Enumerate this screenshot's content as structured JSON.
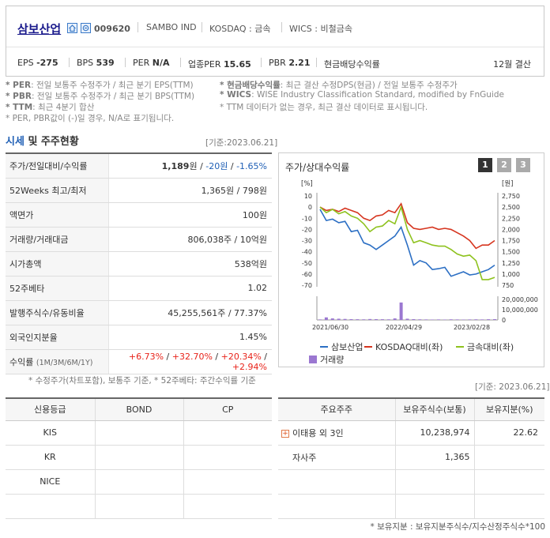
{
  "company": {
    "name": "삼보산업",
    "code": "009620",
    "eng_name": "SAMBO IND",
    "market": "KOSDAQ : 금속",
    "wics": "WICS : 비철금속"
  },
  "metrics": [
    {
      "label": "EPS",
      "value": "-275"
    },
    {
      "label": "BPS",
      "value": "539"
    },
    {
      "label": "PER",
      "value": "N/A"
    },
    {
      "label": "업종PER",
      "value": "15.65"
    },
    {
      "label": "PBR",
      "value": "2.21"
    },
    {
      "label": "현금배당수익률",
      "value": ""
    }
  ],
  "fiscal": "12월 결산",
  "notes": {
    "l1_key": "* PER",
    "l1": ": 전일 보통주 수정주가 / 최근 분기 EPS(TTM)",
    "l2_key": "* PBR",
    "l2": ": 전일 보통주 수정주가 / 최근 분기 BPS(TTM)",
    "l3_key": "* TTM",
    "l3": ": 최근 4분기 합산",
    "l4": "* PER, PBR값이 (-)일 경우, N/A로 표기됩니다.",
    "r1_key": "* 현금배당수익률",
    "r1": ": 최근 결산 수정DPS(현금) / 전일 보통주 수정주가",
    "r2_key": "* WICS",
    "r2": ": WISE Industry Classification Standard, modified by FnGuide",
    "r3": "* TTM 데이터가 없는 경우, 최근 결산 데이터로 표시됩니다."
  },
  "section": {
    "title_a": "시세",
    "title_b": " 및 주주현황",
    "asof": "[기준:2023.06.21]",
    "asof2": "[기준: 2023.06.21]"
  },
  "price_table": [
    {
      "k": "주가/전일대비/수익률",
      "v1": "1,189",
      "v1_unit": "원 / ",
      "v2": "-20원",
      "v3": " / ",
      "v4": "-1.65%"
    },
    {
      "k": "52Weeks 최고/최저",
      "v": "1,365원 / 798원"
    },
    {
      "k": "액면가",
      "v": "100원"
    },
    {
      "k": "거래량/거래대금",
      "v": "806,038주 / 10억원"
    },
    {
      "k": "시가총액",
      "v": "538억원"
    },
    {
      "k": "52주베타",
      "v": "1.02"
    },
    {
      "k": "발행주식수/유동비율",
      "v": "45,255,561주 / 77.37%"
    },
    {
      "k": "외국인지분율",
      "v": "1.45%"
    }
  ],
  "returns": {
    "label": "수익률",
    "periods": "(1M/3M/6M/1Y)",
    "values": [
      "+6.73%",
      "+32.70%",
      "+20.34%",
      "+2.94%"
    ]
  },
  "price_note": "* 수정주가(차트포함), 보통주 기준, * 52주베타: 주간수익률 기준",
  "chart": {
    "title": "주가/상대수익률",
    "buttons": [
      "1",
      "2",
      "3"
    ],
    "left_unit": "[%]",
    "right_unit": "[원]",
    "legend": [
      "삼보산업",
      "KOSDAQ대비(좌)",
      "금속대비(좌)",
      "거래량"
    ]
  },
  "chart_data": {
    "type": "line",
    "x_ticks": [
      "2021/06/30",
      "2022/04/29",
      "2023/02/28"
    ],
    "left_axis": {
      "ticks": [
        10,
        0,
        -10,
        -20,
        -30,
        -40,
        -50,
        -60,
        -70
      ],
      "ylim": [
        -70,
        10
      ]
    },
    "right_axis": {
      "ticks": [
        "2,750",
        "2,500",
        "2,250",
        "2,000",
        "1,750",
        "1,500",
        "1,250",
        "1,000",
        "750"
      ],
      "ylim": [
        750,
        2750
      ]
    },
    "volume_axis": {
      "ticks": [
        "20,000,000",
        "10,000,000",
        "0"
      ],
      "ylim": [
        0,
        20000000
      ]
    },
    "series": [
      {
        "name": "삼보산업",
        "color": "#2c6fc4",
        "axis": "right",
        "values": [
          2450,
          2200,
          2230,
          2150,
          2180,
          1950,
          1980,
          1700,
          1650,
          1550,
          1650,
          1750,
          1850,
          2050,
          1650,
          1200,
          1300,
          1250,
          1100,
          1120,
          1150,
          950,
          1000,
          1050,
          980,
          1000,
          1050,
          1100,
          1200
        ]
      },
      {
        "name": "KOSDAQ대비(좌)",
        "color": "#d6351f",
        "axis": "left",
        "values": [
          0,
          -3,
          -2,
          -4,
          -1,
          -3,
          -5,
          -10,
          -12,
          -8,
          -7,
          -3,
          -5,
          3,
          -14,
          -19,
          -20,
          -19,
          -18,
          -20,
          -19,
          -20,
          -23,
          -26,
          -30,
          -37,
          -34,
          -34,
          -30
        ]
      },
      {
        "name": "금속대비(좌)",
        "color": "#8ec21e",
        "axis": "left",
        "values": [
          0,
          -5,
          -2,
          -6,
          -4,
          -8,
          -10,
          -15,
          -22,
          -18,
          -17,
          -12,
          -15,
          0,
          -20,
          -32,
          -30,
          -32,
          -34,
          -35,
          -35,
          -38,
          -42,
          -44,
          -43,
          -48,
          -65,
          -65,
          -63
        ]
      },
      {
        "name": "거래량",
        "color": "#9b77d1",
        "axis": "volume",
        "values": [
          500000,
          2500000,
          1500000,
          1200000,
          1000000,
          800000,
          700000,
          600000,
          900000,
          800000,
          700000,
          600000,
          1500000,
          17000000,
          1200000,
          800000,
          600000,
          500000,
          400000,
          500000,
          400000,
          600000,
          500000,
          400000,
          500000,
          600000,
          500000,
          700000,
          800000
        ]
      }
    ]
  },
  "credit": {
    "headers": [
      "신용등급",
      "BOND",
      "CP"
    ],
    "rows": [
      "KIS",
      "KR",
      "NICE",
      ""
    ]
  },
  "holders": {
    "headers": [
      "주요주주",
      "보유주식수(보통)",
      "보유지분(%)"
    ],
    "rows": [
      {
        "name": "이태용 외 3인",
        "shares": "10,238,974",
        "pct": "22.62"
      },
      {
        "name": "자사주",
        "shares": "1,365",
        "pct": ""
      },
      {
        "name": "",
        "shares": "",
        "pct": ""
      },
      {
        "name": "",
        "shares": "",
        "pct": ""
      }
    ],
    "note": "* 보유지분 : 보유지분주식수/지수산정주식수*100"
  }
}
